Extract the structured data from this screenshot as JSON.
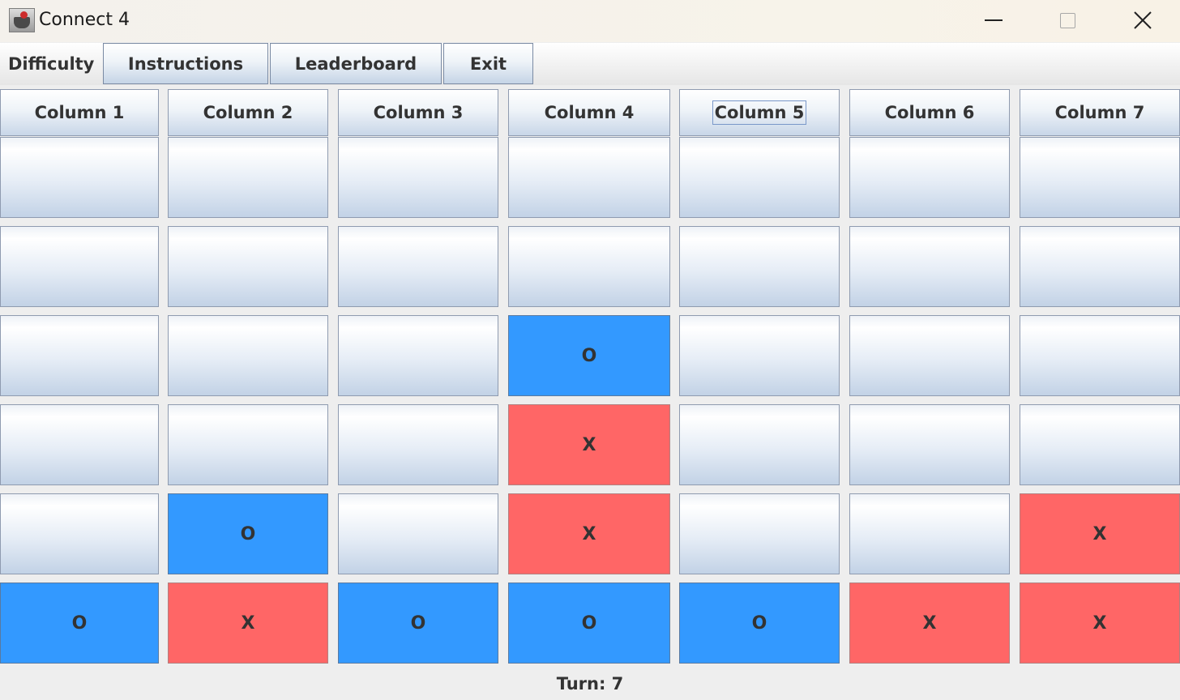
{
  "window": {
    "title": "Connect 4"
  },
  "menubar": {
    "difficulty_label": "Difficulty",
    "instructions_label": "Instructions",
    "leaderboard_label": "Leaderboard",
    "exit_label": "Exit"
  },
  "board": {
    "columns": [
      "Column 1",
      "Column 2",
      "Column 3",
      "Column 4",
      "Column 5",
      "Column 6",
      "Column 7"
    ],
    "focused_column": "Column 5",
    "rows": [
      [
        "",
        "",
        "",
        "",
        "",
        "",
        ""
      ],
      [
        "",
        "",
        "",
        "",
        "",
        "",
        ""
      ],
      [
        "",
        "",
        "",
        "O",
        "",
        "",
        ""
      ],
      [
        "",
        "",
        "",
        "X",
        "",
        "",
        ""
      ],
      [
        "",
        "O",
        "",
        "X",
        "",
        "",
        "X"
      ],
      [
        "O",
        "X",
        "O",
        "O",
        "O",
        "X",
        "X"
      ]
    ],
    "colors": {
      "O": "#3399ff",
      "X": "#ff6666",
      "empty": "#e6edf6"
    }
  },
  "status": {
    "turn_text": "Turn: 7"
  }
}
